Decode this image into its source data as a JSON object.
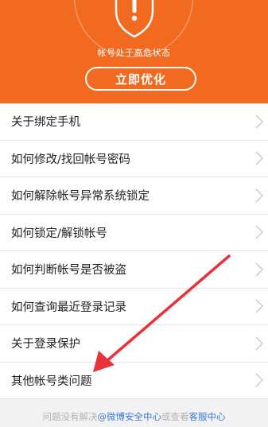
{
  "header": {
    "status_text": "帐号处于高危状态",
    "optimize_button": "立即优化",
    "accent_color": "#f26a1f",
    "icon": "shield-warning-icon"
  },
  "menu": {
    "items": [
      {
        "label": "关于绑定手机"
      },
      {
        "label": "如何修改/找回帐号密码"
      },
      {
        "label": "如何解除帐号异常系统锁定"
      },
      {
        "label": "如何锁定/解锁帐号"
      },
      {
        "label": "如何判断帐号是否被盗"
      },
      {
        "label": "如何查询最近登录记录"
      },
      {
        "label": "关于登录保护"
      },
      {
        "label": "其他帐号类问题"
      }
    ],
    "chevron_icon": "chevron-right-icon"
  },
  "footer": {
    "text_1": "问题没有解决",
    "link_1": "@微博安全中心",
    "text_2": "或查看",
    "link_2": "客服中心"
  },
  "annotation": {
    "color": "#e8323a",
    "icon": "red-arrow-annotation"
  }
}
